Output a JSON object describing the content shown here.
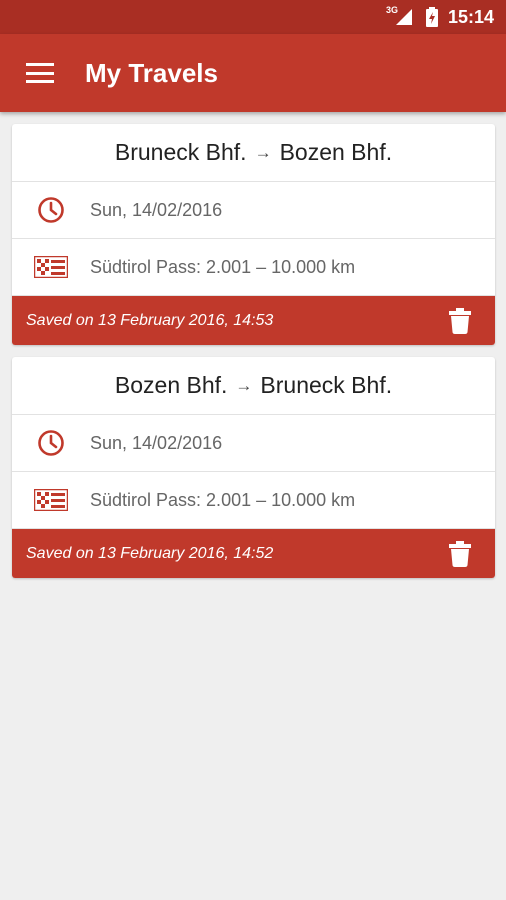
{
  "status_bar": {
    "network": "3G",
    "time": "15:14"
  },
  "app_bar": {
    "title": "My Travels",
    "menu_icon": "hamburger-menu-icon"
  },
  "colors": {
    "primary": "#c0392b",
    "status_bar": "#a92e23",
    "background": "#efefef"
  },
  "travels": [
    {
      "from": "Bruneck Bhf.",
      "arrow": "→",
      "to": "Bozen Bhf.",
      "date": "Sun, 14/02/2016",
      "pass": "Südtirol Pass: 2.001 – 10.000 km",
      "saved": "Saved on 13 February 2016, 14:53"
    },
    {
      "from": "Bozen Bhf.",
      "arrow": "→",
      "to": "Bruneck Bhf.",
      "date": "Sun, 14/02/2016",
      "pass": "Südtirol Pass: 2.001 – 10.000 km",
      "saved": "Saved on 13 February 2016, 14:52"
    }
  ]
}
